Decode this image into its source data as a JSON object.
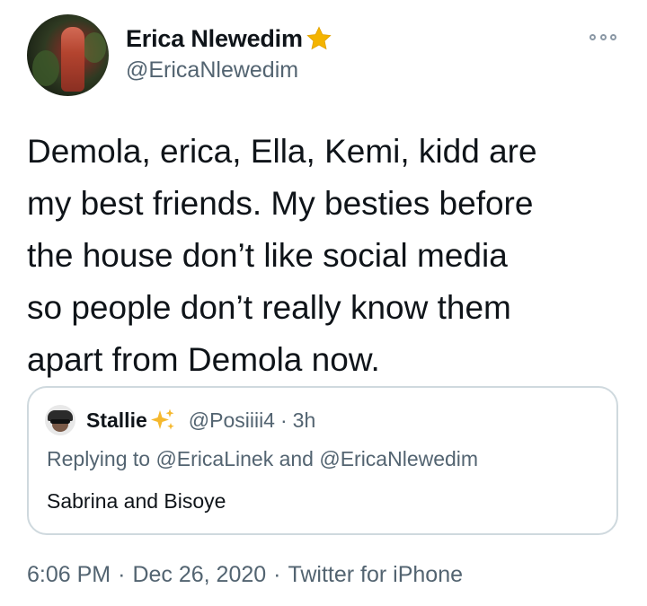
{
  "author": {
    "display_name": "Erica Nlewedim",
    "handle": "@EricaNlewedim",
    "badge_icon": "star-icon",
    "badge_color": "#f4b400"
  },
  "tweet": {
    "text": "Demola, erica, Ella, Kemi, kidd are\nmy best friends. My besties before\nthe house don’t like social media\nso people don’t really know them\napart from Demola now."
  },
  "quote": {
    "display_name": "Stallie",
    "name_emoji_icon": "sparkles-icon",
    "handle": "@Posiiii4",
    "separator": "·",
    "time": "3h",
    "replying_to": "Replying to @EricaLinek and @EricaNlewedim",
    "text": "Sabrina and Bisoye"
  },
  "meta": {
    "time": "6:06 PM",
    "separator": "·",
    "date": "Dec 26, 2020",
    "source": "Twitter for iPhone"
  },
  "colors": {
    "text_primary": "#0f1419",
    "text_secondary": "#536471",
    "border": "#cfd9de"
  }
}
